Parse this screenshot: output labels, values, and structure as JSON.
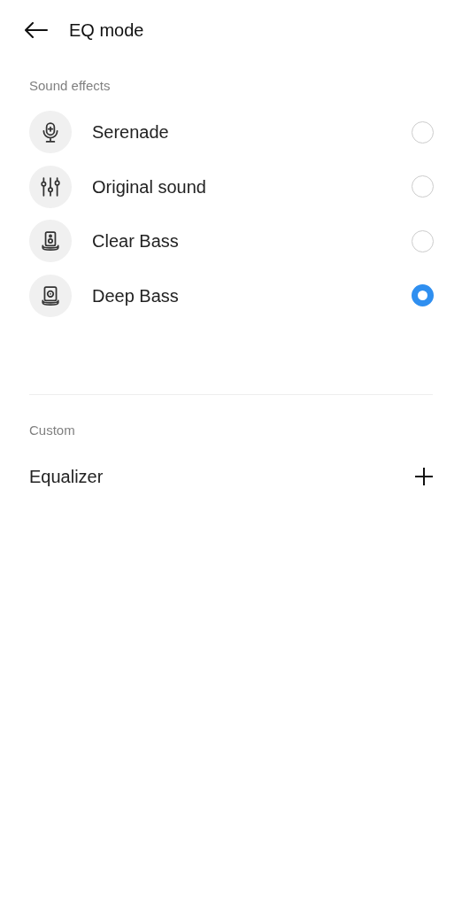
{
  "header": {
    "title": "EQ mode"
  },
  "sound_effects": {
    "heading": "Sound effects",
    "items": [
      {
        "kind": "microphone",
        "label": "Serenade",
        "selected": false
      },
      {
        "kind": "sliders",
        "label": "Original sound",
        "selected": false
      },
      {
        "kind": "speaker",
        "label": "Clear Bass",
        "selected": false
      },
      {
        "kind": "woofer",
        "label": "Deep Bass",
        "selected": true
      }
    ]
  },
  "custom": {
    "heading": "Custom",
    "items": [
      {
        "label": "Equalizer"
      }
    ]
  }
}
